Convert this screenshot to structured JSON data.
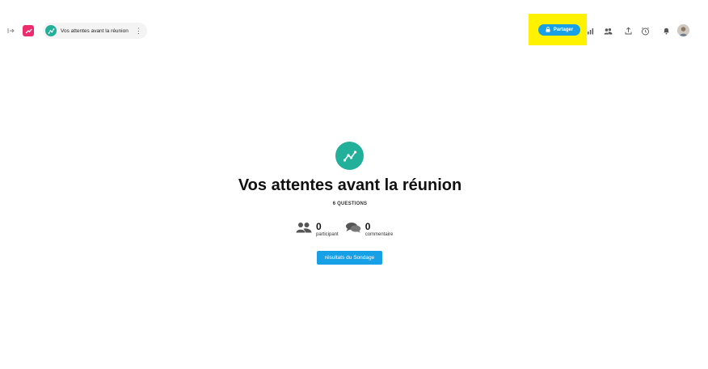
{
  "header": {
    "survey_title": "Vos attentes avant la réunion",
    "more_glyph": "⋮",
    "share_label": "Partager",
    "icons": [
      "expand-icon",
      "app-logo-icon",
      "survey-icon",
      "lock-icon",
      "bar-chart-icon",
      "users-icon",
      "upload-icon",
      "clock-icon",
      "bell-icon",
      "avatar"
    ]
  },
  "main": {
    "title": "Vos attentes avant la réunion",
    "questions_label": "6 QUESTIONS",
    "stats": [
      {
        "value": "0",
        "label": "participant",
        "icon": "participants-icon"
      },
      {
        "value": "0",
        "label": "commentaire",
        "icon": "comments-icon"
      }
    ],
    "results_button": "résultats du Sondage"
  },
  "colors": {
    "accent_blue": "#18a0e6",
    "teal": "#22b09a",
    "brand_pink": "#ee2b6c",
    "highlight_yellow": "#fff200"
  }
}
